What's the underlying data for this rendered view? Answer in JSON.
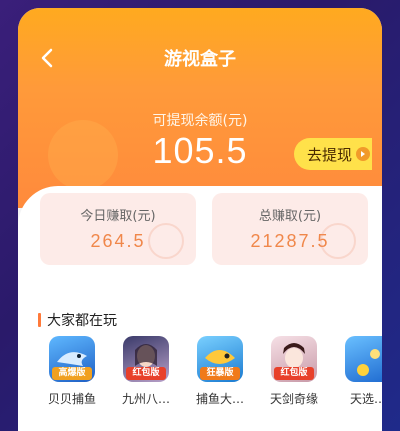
{
  "header": {
    "title": "游视盒子",
    "balance_label": "可提现余额(元)",
    "balance_value": "105.5",
    "withdraw_label": "去提现"
  },
  "stats": [
    {
      "label": "今日赚取(元)",
      "value": "264.5"
    },
    {
      "label": "总赚取(元)",
      "value": "21287.5"
    }
  ],
  "games_section": {
    "title": "大家都在玩",
    "items": [
      {
        "name": "贝贝捕鱼",
        "tag": "高爆版",
        "icon": "shark-game-icon",
        "color": "#2a6fd6"
      },
      {
        "name": "九州八…",
        "tag": "红包版",
        "icon": "heroine-game-icon",
        "color": "#7a5a9a"
      },
      {
        "name": "捕鱼大…",
        "tag": "狂暴版",
        "icon": "fish-game-icon",
        "color": "#1a8ad0"
      },
      {
        "name": "天剑奇缘",
        "tag": "红包版",
        "icon": "girl-game-icon",
        "color": "#d8a8b8"
      },
      {
        "name": "天选…",
        "tag": "",
        "icon": "ocean-game-icon",
        "color": "#3a8ae0"
      }
    ]
  },
  "colors": {
    "accent": "#ff9a3a",
    "withdraw_bg": "#ffe14a",
    "stat_value": "#f0874a"
  }
}
